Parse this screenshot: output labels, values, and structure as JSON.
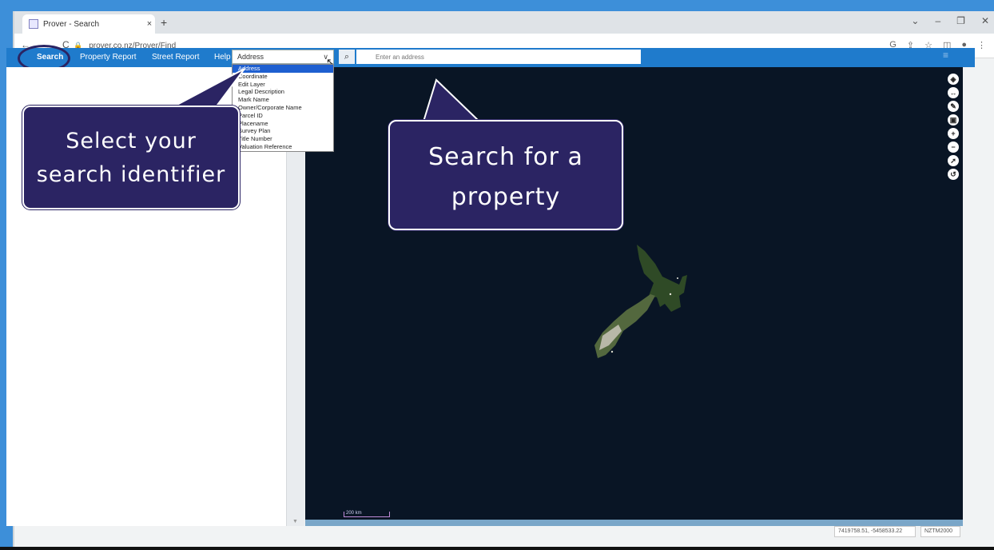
{
  "browser": {
    "tab_title": "Prover - Search",
    "new_tab": "+",
    "url": "prover.co.nz/Prover/Find"
  },
  "app_nav": {
    "items": [
      {
        "label": "Search",
        "active": true
      },
      {
        "label": "Property Report"
      },
      {
        "label": "Street Report"
      },
      {
        "label": "Help"
      }
    ],
    "search_type_selected": "Address",
    "search_placeholder": "Enter an address"
  },
  "dropdown_options": [
    "Address",
    "Coordinate",
    "Edit Layer",
    "Legal Description",
    "Mark Name",
    "Owner/Corporate Name",
    "Parcel ID",
    "Placename",
    "Survey Plan",
    "Title Number",
    "Valuation Reference"
  ],
  "callouts": {
    "left": [
      "Select your",
      "search identifier"
    ],
    "right": [
      "Search for a",
      "property"
    ]
  },
  "map": {
    "scale_label": "200 km",
    "coordinates": "7419758.51, -5458533.22",
    "projection": "NZTM2000"
  },
  "colors": {
    "nav_blue": "#1f7bcc",
    "callout_purple": "#2b2463",
    "map_bg": "#091525"
  }
}
